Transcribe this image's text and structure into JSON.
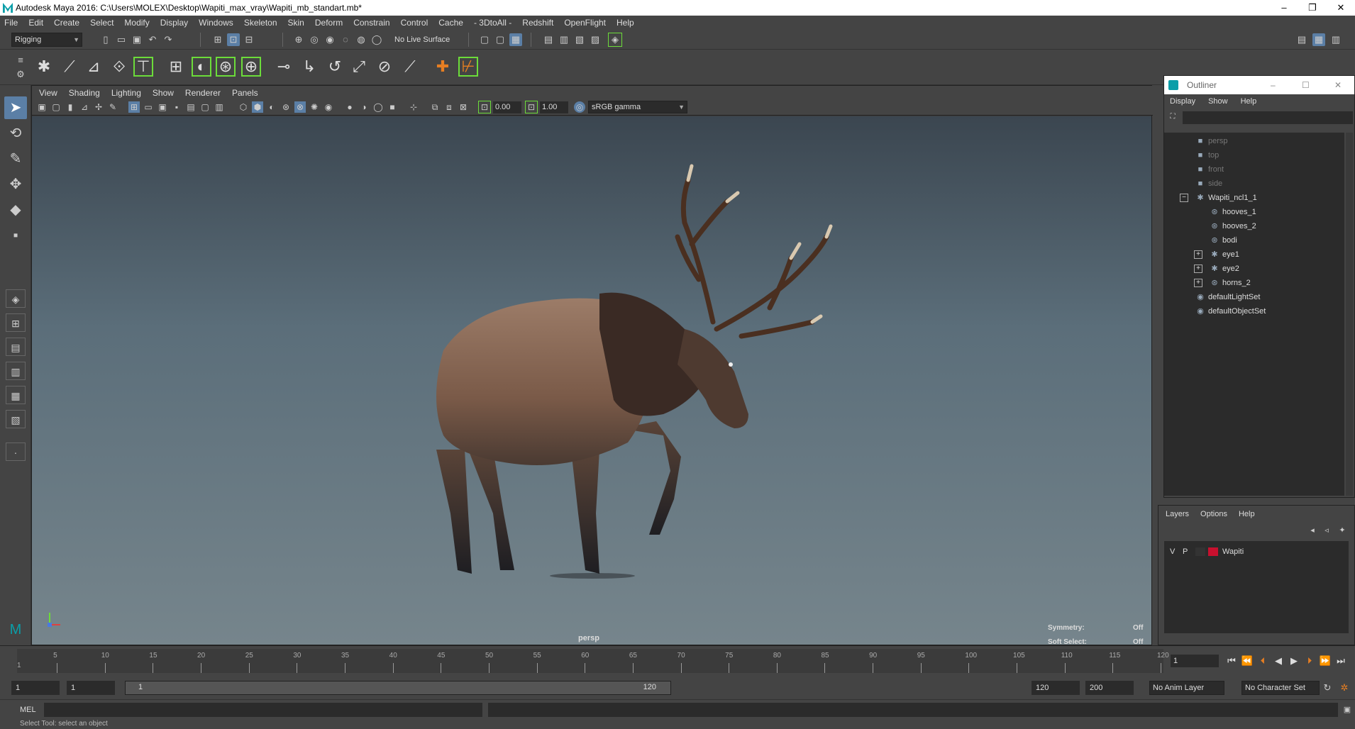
{
  "window": {
    "title": "Autodesk Maya 2016: C:\\Users\\MOLEX\\Desktop\\Wapiti_max_vray\\Wapiti_mb_standart.mb*",
    "min": "–",
    "max": "❐",
    "close": "✕"
  },
  "menubar": [
    "File",
    "Edit",
    "Create",
    "Select",
    "Modify",
    "Display",
    "Windows",
    "Skeleton",
    "Skin",
    "Deform",
    "Constrain",
    "Control",
    "Cache",
    "- 3DtoAll -",
    "Redshift",
    "OpenFlight",
    "Help"
  ],
  "statusline": {
    "mode": "Rigging",
    "live_surface": "No Live Surface"
  },
  "viewport": {
    "menu": [
      "View",
      "Shading",
      "Lighting",
      "Show",
      "Renderer",
      "Panels"
    ],
    "exposure": "0.00",
    "gamma": "1.00",
    "colorspace": "sRGB gamma",
    "camera": "persp",
    "symmetry_label": "Symmetry:",
    "symmetry_value": "Off",
    "softselect_label": "Soft Select:",
    "softselect_value": "Off"
  },
  "outliner": {
    "title": "Outliner",
    "menu": [
      "Display",
      "Show",
      "Help"
    ],
    "items": [
      {
        "label": "persp",
        "dim": true
      },
      {
        "label": "top",
        "dim": true
      },
      {
        "label": "front",
        "dim": true
      },
      {
        "label": "side",
        "dim": true
      },
      {
        "label": "Wapiti_ncl1_1"
      },
      {
        "label": "hooves_1"
      },
      {
        "label": "hooves_2"
      },
      {
        "label": "bodi"
      },
      {
        "label": "eye1"
      },
      {
        "label": "eye2"
      },
      {
        "label": "horns_2"
      },
      {
        "label": "defaultLightSet"
      },
      {
        "label": "defaultObjectSet"
      }
    ]
  },
  "layers": {
    "menu": [
      "Layers",
      "Options",
      "Help"
    ],
    "row": {
      "v": "V",
      "p": "P",
      "name": "Wapiti",
      "color": "#c8102e"
    }
  },
  "timeline": {
    "labels": [
      "5",
      "10",
      "15",
      "20",
      "25",
      "30",
      "35",
      "40",
      "45",
      "50",
      "55",
      "60",
      "65",
      "70",
      "75",
      "80",
      "85",
      "90",
      "95",
      "100",
      "105",
      "110",
      "115",
      "120"
    ],
    "current": "1",
    "start_mark": "1"
  },
  "range": {
    "start": "1",
    "anim_start": "1",
    "slider_start": "1",
    "slider_end": "120",
    "end": "120",
    "anim_end": "200",
    "anim_layer": "No Anim Layer",
    "char_set": "No Character Set"
  },
  "cmdline": {
    "label": "MEL"
  },
  "helpline": {
    "text": "Select Tool: select an object"
  }
}
